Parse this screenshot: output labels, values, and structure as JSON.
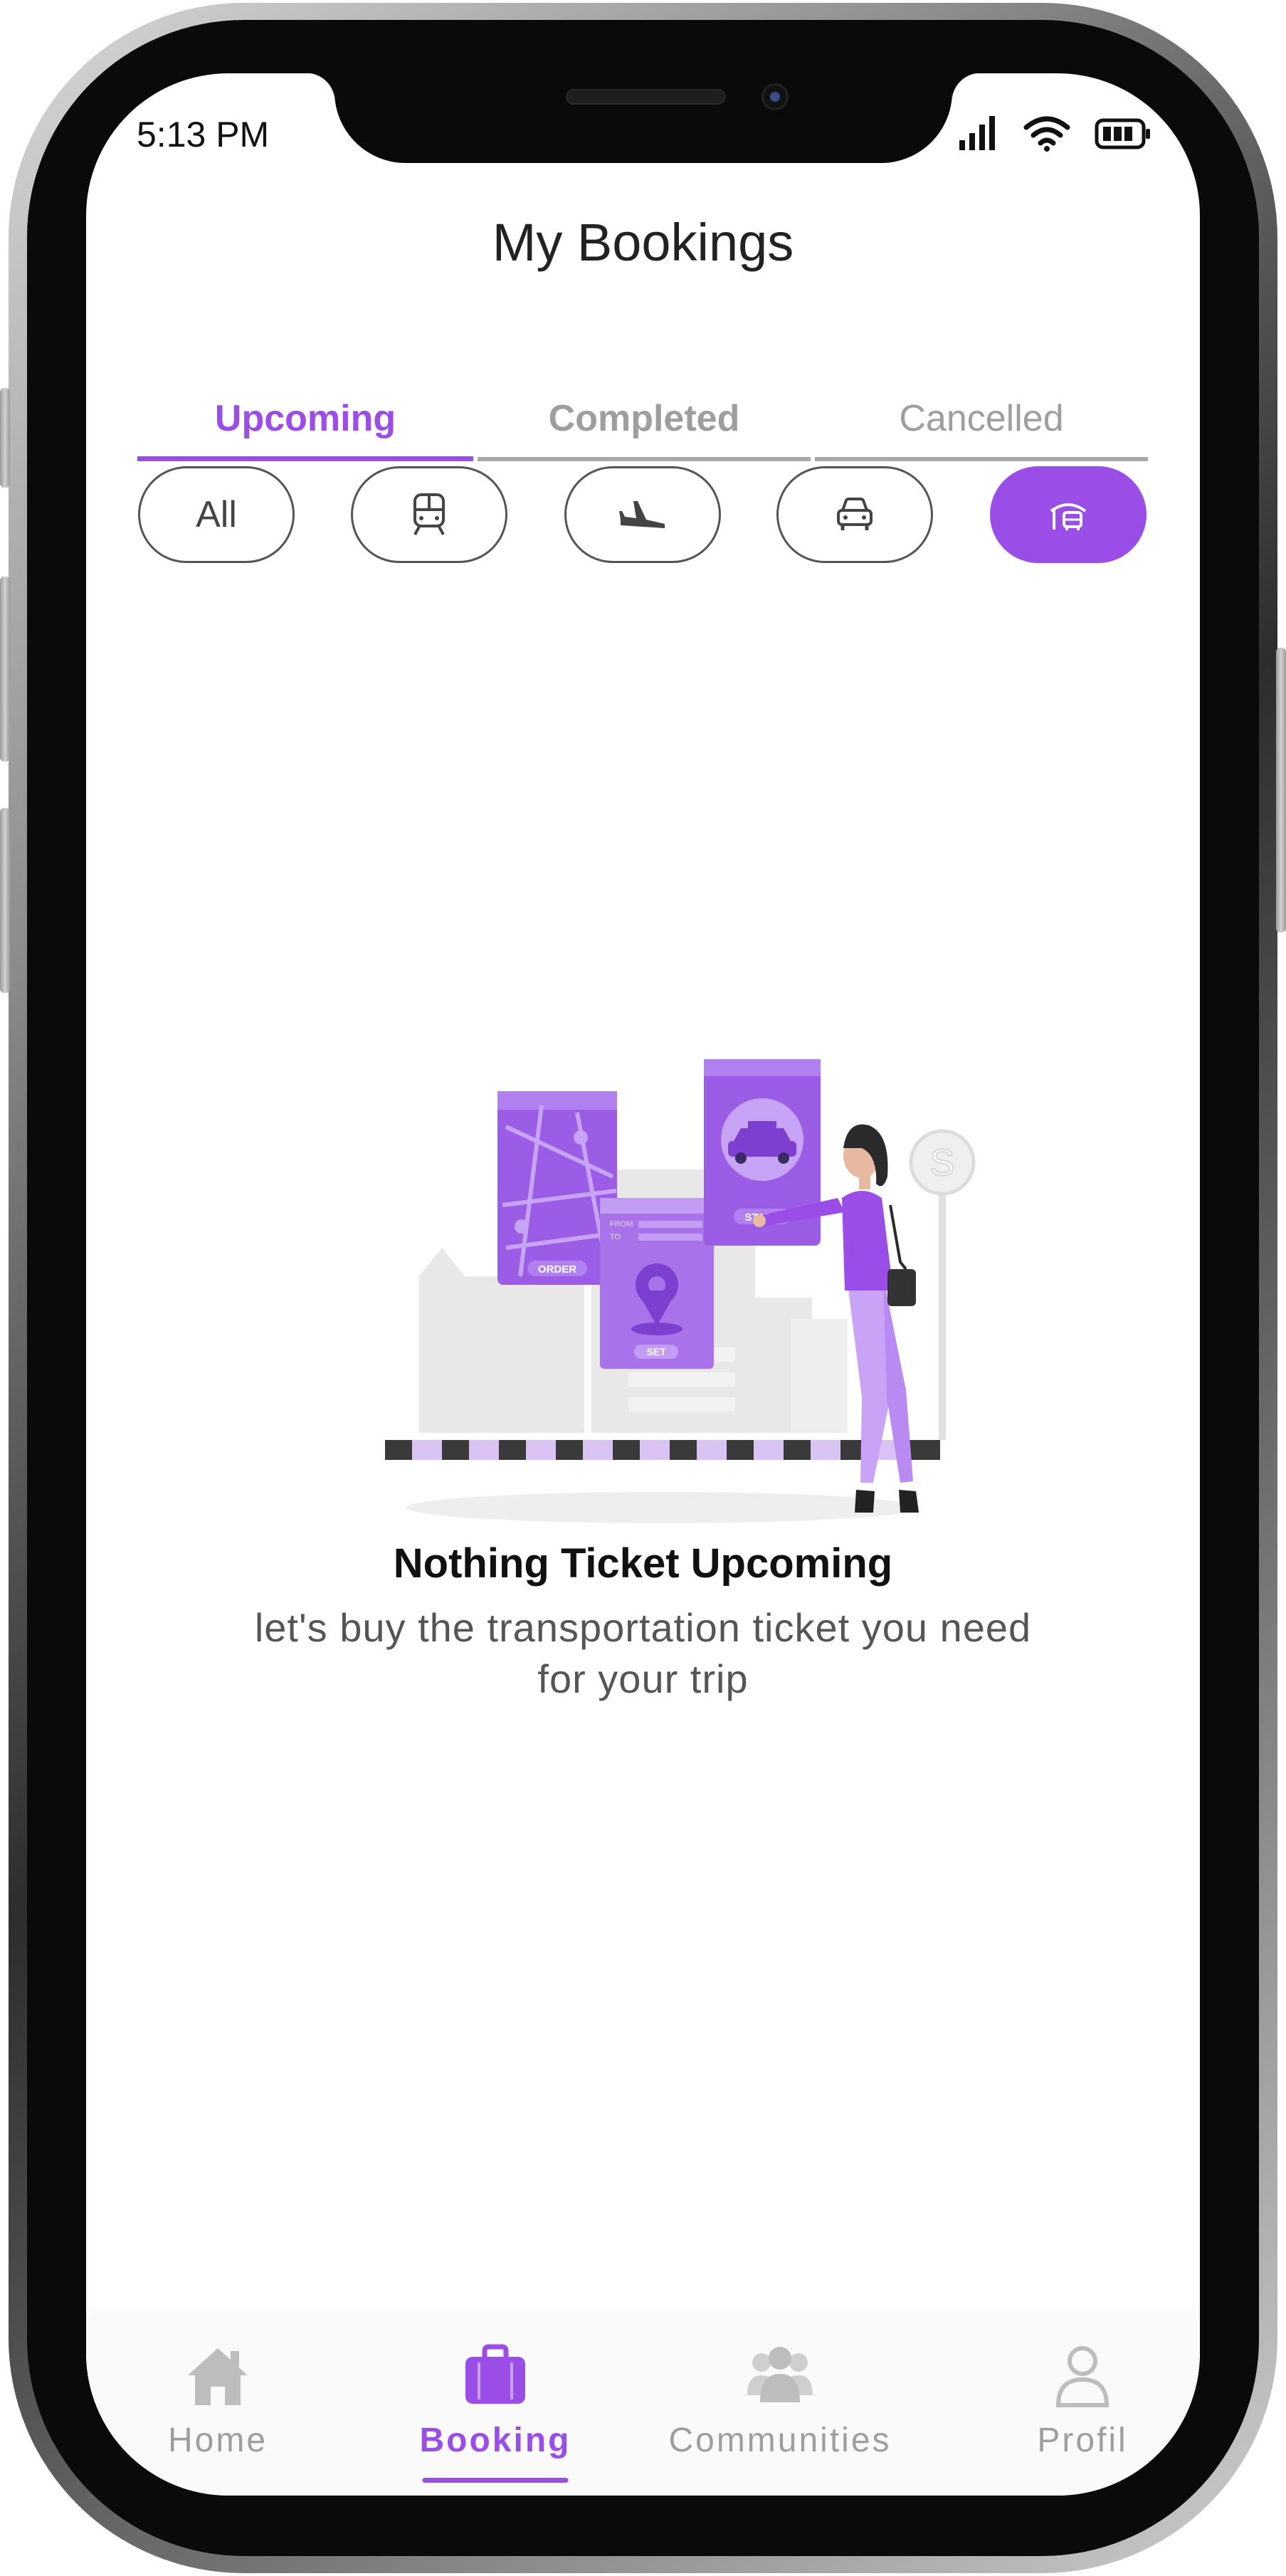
{
  "status_bar": {
    "time": "5:13 PM"
  },
  "header": {
    "title": "My Bookings"
  },
  "tabs": [
    {
      "label": "Upcoming",
      "active": true
    },
    {
      "label": "Completed",
      "active": false
    },
    {
      "label": "Cancelled",
      "active": false
    }
  ],
  "filters": {
    "all_label": "All",
    "items": [
      {
        "icon": "train-icon",
        "active": false
      },
      {
        "icon": "plane-icon",
        "active": false
      },
      {
        "icon": "car-icon",
        "active": false
      },
      {
        "icon": "bus-stop-icon",
        "active": true
      }
    ]
  },
  "illustration": {
    "order_label": "ORDER",
    "set_label": "SET",
    "start_label": "START",
    "from_label": "FROM",
    "to_label": "TO",
    "sign_letter": "S"
  },
  "empty_state": {
    "title": "Nothing Ticket Upcoming",
    "description": "let's buy the transportation ticket you need for your trip"
  },
  "bottom_nav": [
    {
      "label": "Home",
      "icon": "home-icon",
      "active": false
    },
    {
      "label": "Booking",
      "icon": "briefcase-icon",
      "active": true
    },
    {
      "label": "Communities",
      "icon": "people-icon",
      "active": false
    },
    {
      "label": "Profil",
      "icon": "person-icon",
      "active": false
    }
  ],
  "colors": {
    "accent": "#9b4de8",
    "inactive": "#9e9e9e",
    "text": "#222222"
  }
}
